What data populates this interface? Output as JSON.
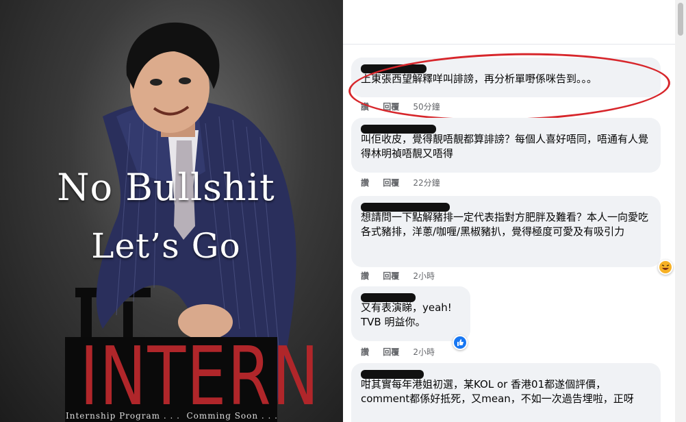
{
  "poster": {
    "line1": "No Bullshit",
    "line2": "Let’s Go",
    "big": "INTERN",
    "sub_left": "Internship Program . . .",
    "sub_right": "Comming Soon . . ."
  },
  "comments": [
    {
      "text": "上東張西望解釋咩叫誹謗，再分析單嘢係咪告到。。。",
      "like": "讚",
      "reply": "回覆",
      "time": "50分鐘",
      "highlighted": true
    },
    {
      "text": "叫佢收皮，覺得靚唔靚都算誹謗？每個人喜好唔同，唔通有人覺得林明禎唔靚又唔得",
      "like": "讚",
      "reply": "回覆",
      "time": "22分鐘"
    },
    {
      "text": "想請問一下點解豬排一定代表指對方肥胖及難看？本人一向愛吃各式豬排，洋蔥/咖喱/黑椒豬扒，覺得極度可愛及有吸引力",
      "like": "讚",
      "reply": "回覆",
      "time": "2小時",
      "reaction": "haha-emoji"
    },
    {
      "text": "又有表演睇，yeah!\nTVB 明益你。",
      "like": "讚",
      "reply": "回覆",
      "time": "2小時",
      "reaction": "like-thumb"
    },
    {
      "text": "咁其實每年港姐初選，某KOL or 香港01都遂個評價，comment都係好抵死，又mean，不如一次過告埋啦，正呀",
      "like": "",
      "reply": "",
      "time": ""
    }
  ],
  "colors": {
    "highlight": "#d7262b",
    "intern": "#b0262a",
    "bubble": "#f0f2f5"
  }
}
